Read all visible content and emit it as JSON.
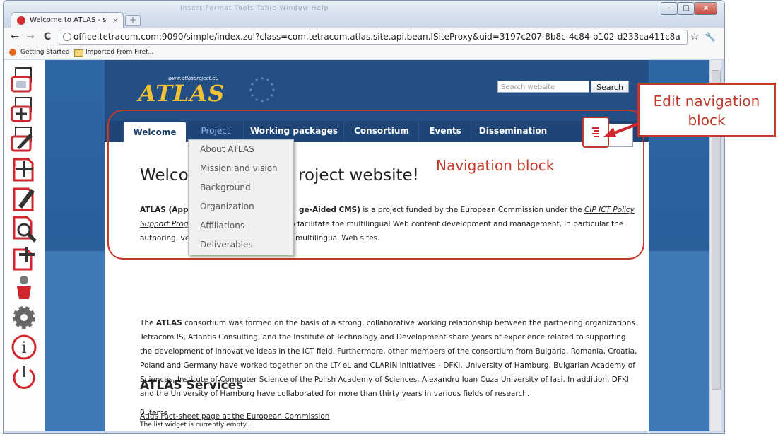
{
  "browser": {
    "tab_title": "Welcome to ATLAS - simpl",
    "tab_close": "×",
    "new_tab": "+",
    "url": "office.tetracom.com:9090/simple/index.zul?class=com.tetracom.atlas.site.api.bean.ISiteProxy&uid=3197c207-8b8c-4c84-b102-d233ca411c8a",
    "faded_menu": "Insert   Format   Tools   Table   Window   Help",
    "bookmarks": [
      "Getting Started",
      "Imported From Firef..."
    ],
    "window_buttons": {
      "minimize": "–",
      "maximize": "□",
      "close": "x"
    },
    "nav": {
      "back": "←",
      "forward": "→",
      "reload": "C",
      "star": "☆",
      "wrench": "🔧"
    }
  },
  "cms_toolbar": {
    "icons": [
      "move-page-icon",
      "add-page-icon",
      "edit-page-icon",
      "add-item-icon",
      "edit-item-icon",
      "preview-icon",
      "add-block-icon",
      "user-icon",
      "settings-icon",
      "info-icon",
      "logout-icon"
    ]
  },
  "site": {
    "logo_url_text": "www.atlasproject.eu",
    "logo_text": "ATLAS",
    "search": {
      "placeholder": "Search website",
      "button": "Search"
    },
    "menu": [
      "Welcome",
      "Project",
      "Working packages",
      "Consortium",
      "Events",
      "Dissemination"
    ],
    "dropdown": [
      "About ATLAS",
      "Mission and vision",
      "Background",
      "Organization",
      "Affiliations",
      "Deliverables"
    ],
    "heading_left": "Welco",
    "heading_right": "roject website!",
    "p1": {
      "bold_left": "ATLAS (Appl",
      "bold_right": "ge-Aided CMS)",
      "text1": " is a project funded by the European Commission under the ",
      "link": "CIP ICT Policy",
      "link2": "Support Prog",
      "text2": "o facilitate the multilingual Web content development and management, in particular the",
      "text3_left": "authoring, ve",
      "text3_right": "multilingual Web sites."
    },
    "p2": {
      "line1_a": "The ",
      "line1_bold": "ATLAS",
      "line1_b": " consortium was formed on the basis of a strong, collaborative working relationship between the partnering organizations.",
      "line2": "Tetracom IS, Atlantis Consulting, and the Institute of Technology and Development share years of experience related to supporting",
      "line3": "the development of innovative ideas in the ICT field. Furthermore, other members of the consortium from Bulgaria, Romania, Croatia,",
      "line4": "Poland and Germany have worked together on the LT4eL and CLARIN initiatives - DFKI, University of Hamburg, Bulgarian Academy of",
      "line5": "Sciences, Institute of Computer Science of the Polish Academy of Sciences, Alexandru Ioan Cuza University of Iasi. In addition, DFKI",
      "line6": "and the University of Hamburg have collaborated for more than thirty years in various fields of research."
    },
    "factsheet_link": "Atlas Fact-sheet page at the European Commission",
    "services_heading": "ATLAS Services",
    "items_count": "0 items",
    "empty_text": "The list widget is currently empty..."
  },
  "annotations": {
    "edit_nav": [
      "Edit navigation",
      "block"
    ],
    "nav_block": "Navigation block"
  },
  "colors": {
    "accent_red": "#c0392b",
    "site_blue": "#2a5f9c",
    "menu_blue": "#1f4577",
    "logo_gold": "#f2c230"
  }
}
